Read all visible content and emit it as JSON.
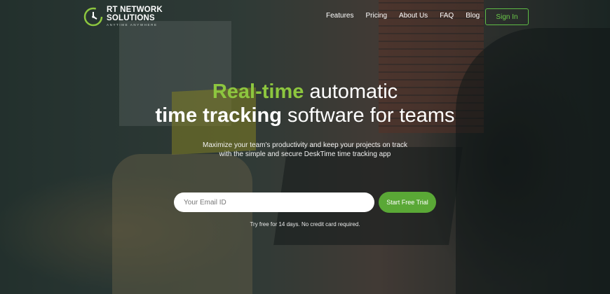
{
  "brand": {
    "name": "RT NETWORK SOLUTIONS",
    "name_line1": "RT NETWORK",
    "name_line2": "SOLUTIONS",
    "tagline": "ANYTIME ANYWHERE",
    "accent": "#8dc63f"
  },
  "nav": {
    "items": [
      {
        "label": "Features"
      },
      {
        "label": "Pricing"
      },
      {
        "label": "About Us"
      },
      {
        "label": "FAQ"
      },
      {
        "label": "Blog"
      }
    ],
    "signin_label": "Sign In"
  },
  "hero": {
    "headline_green": "Real-time",
    "headline_rest": "automatic",
    "headline2_bold": "time tracking",
    "headline2_rest": "software for teams",
    "subtitle_line1": "Maximize your team's productivity and keep your projects on track",
    "subtitle_line2": "with the simple and secure DeskTime time tracking app",
    "email_placeholder": "Your Email ID",
    "cta_label": "Start Free Trial",
    "note": "Try free for 14 days. No credit card required.",
    "cta_color": "#5aa836"
  }
}
